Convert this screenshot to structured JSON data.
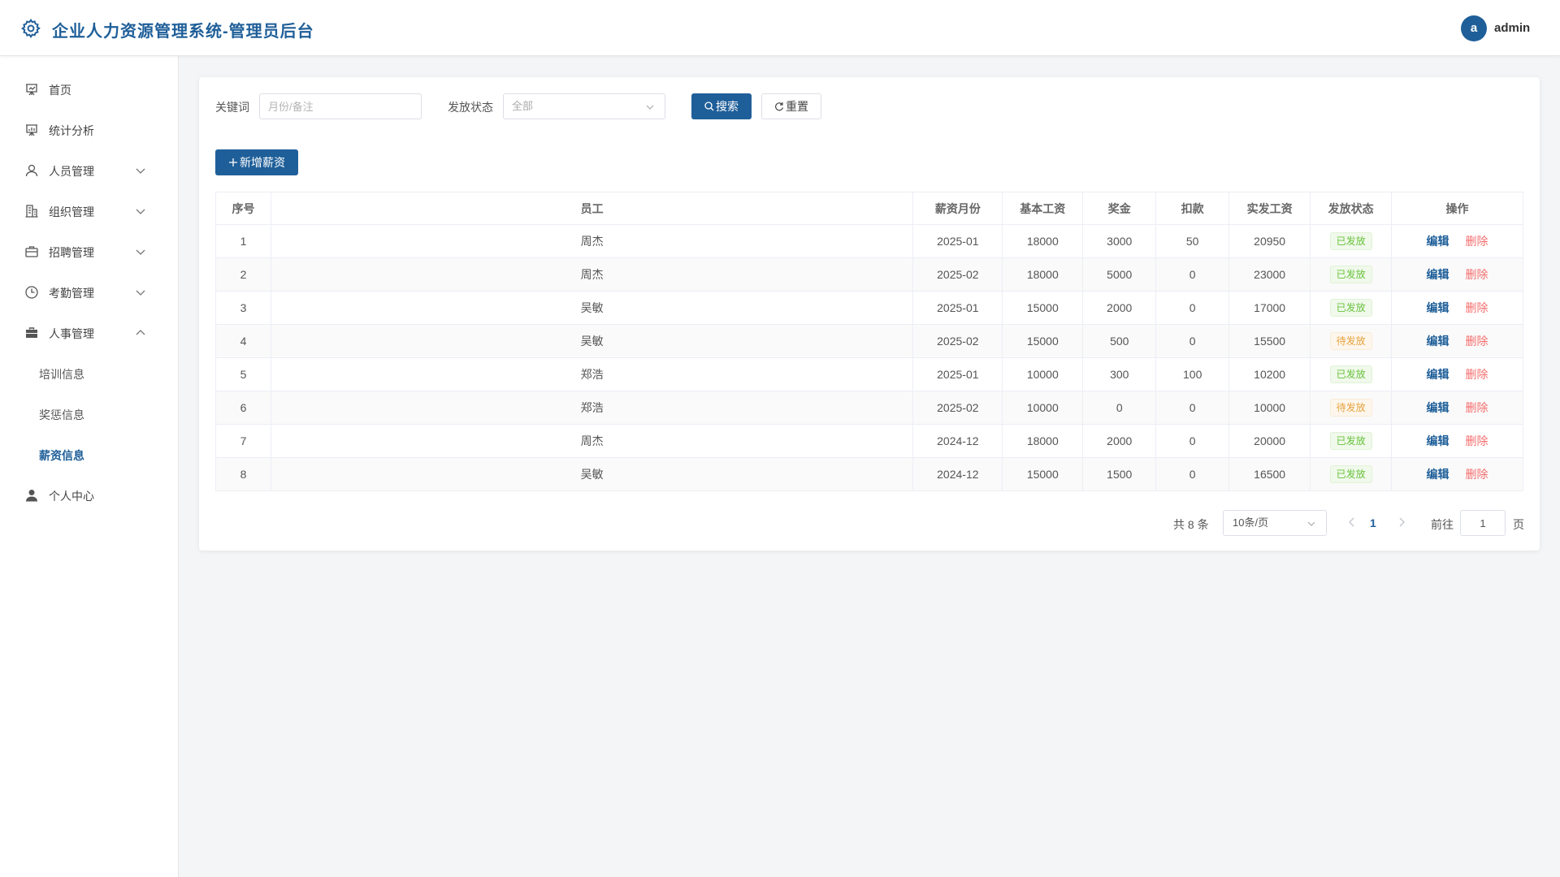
{
  "header": {
    "title": "企业人力资源管理系统-管理员后台",
    "avatar_letter": "a",
    "username": "admin"
  },
  "sidebar": {
    "items": [
      {
        "label": "首页",
        "icon": "presentation-icon"
      },
      {
        "label": "统计分析",
        "icon": "chart-board-icon"
      },
      {
        "label": "人员管理",
        "icon": "user-icon",
        "expanded": false
      },
      {
        "label": "组织管理",
        "icon": "office-building-icon",
        "expanded": false
      },
      {
        "label": "招聘管理",
        "icon": "briefcase-icon",
        "expanded": false
      },
      {
        "label": "考勤管理",
        "icon": "clock-icon",
        "expanded": false
      },
      {
        "label": "人事管理",
        "icon": "suitcase-icon",
        "expanded": true
      },
      {
        "label": "个人中心",
        "icon": "user-filled-icon"
      }
    ],
    "sub_items": [
      {
        "label": "培训信息",
        "active": false
      },
      {
        "label": "奖惩信息",
        "active": false
      },
      {
        "label": "薪资信息",
        "active": true
      }
    ]
  },
  "filter": {
    "keyword_label": "关键词",
    "keyword_placeholder": "月份/备注",
    "status_label": "发放状态",
    "status_value": "全部",
    "search_label": "搜索",
    "reset_label": "重置",
    "add_label": "新增薪资"
  },
  "table": {
    "headers": [
      "序号",
      "员工",
      "薪资月份",
      "基本工资",
      "奖金",
      "扣款",
      "实发工资",
      "发放状态",
      "操作"
    ],
    "rows": [
      {
        "no": "1",
        "employee": "周杰",
        "month": "2025-01",
        "base": "18000",
        "bonus": "3000",
        "deduction": "50",
        "actual": "20950",
        "status": "已发放"
      },
      {
        "no": "2",
        "employee": "周杰",
        "month": "2025-02",
        "base": "18000",
        "bonus": "5000",
        "deduction": "0",
        "actual": "23000",
        "status": "已发放"
      },
      {
        "no": "3",
        "employee": "吴敏",
        "month": "2025-01",
        "base": "15000",
        "bonus": "2000",
        "deduction": "0",
        "actual": "17000",
        "status": "已发放"
      },
      {
        "no": "4",
        "employee": "吴敏",
        "month": "2025-02",
        "base": "15000",
        "bonus": "500",
        "deduction": "0",
        "actual": "15500",
        "status": "待发放"
      },
      {
        "no": "5",
        "employee": "郑浩",
        "month": "2025-01",
        "base": "10000",
        "bonus": "300",
        "deduction": "100",
        "actual": "10200",
        "status": "已发放"
      },
      {
        "no": "6",
        "employee": "郑浩",
        "month": "2025-02",
        "base": "10000",
        "bonus": "0",
        "deduction": "0",
        "actual": "10000",
        "status": "待发放"
      },
      {
        "no": "7",
        "employee": "周杰",
        "month": "2024-12",
        "base": "18000",
        "bonus": "2000",
        "deduction": "0",
        "actual": "20000",
        "status": "已发放"
      },
      {
        "no": "8",
        "employee": "吴敏",
        "month": "2024-12",
        "base": "15000",
        "bonus": "1500",
        "deduction": "0",
        "actual": "16500",
        "status": "已发放"
      }
    ],
    "edit_label": "编辑",
    "delete_label": "删除"
  },
  "pagination": {
    "total_text": "共 8 条",
    "page_size": "10条/页",
    "current_page": "1",
    "goto_label": "前往",
    "goto_value": "1",
    "page_suffix": "页"
  },
  "colors": {
    "primary": "#1f5f99",
    "paid": "#67c23a",
    "pending": "#e6a23c",
    "danger": "#f56c6c"
  }
}
